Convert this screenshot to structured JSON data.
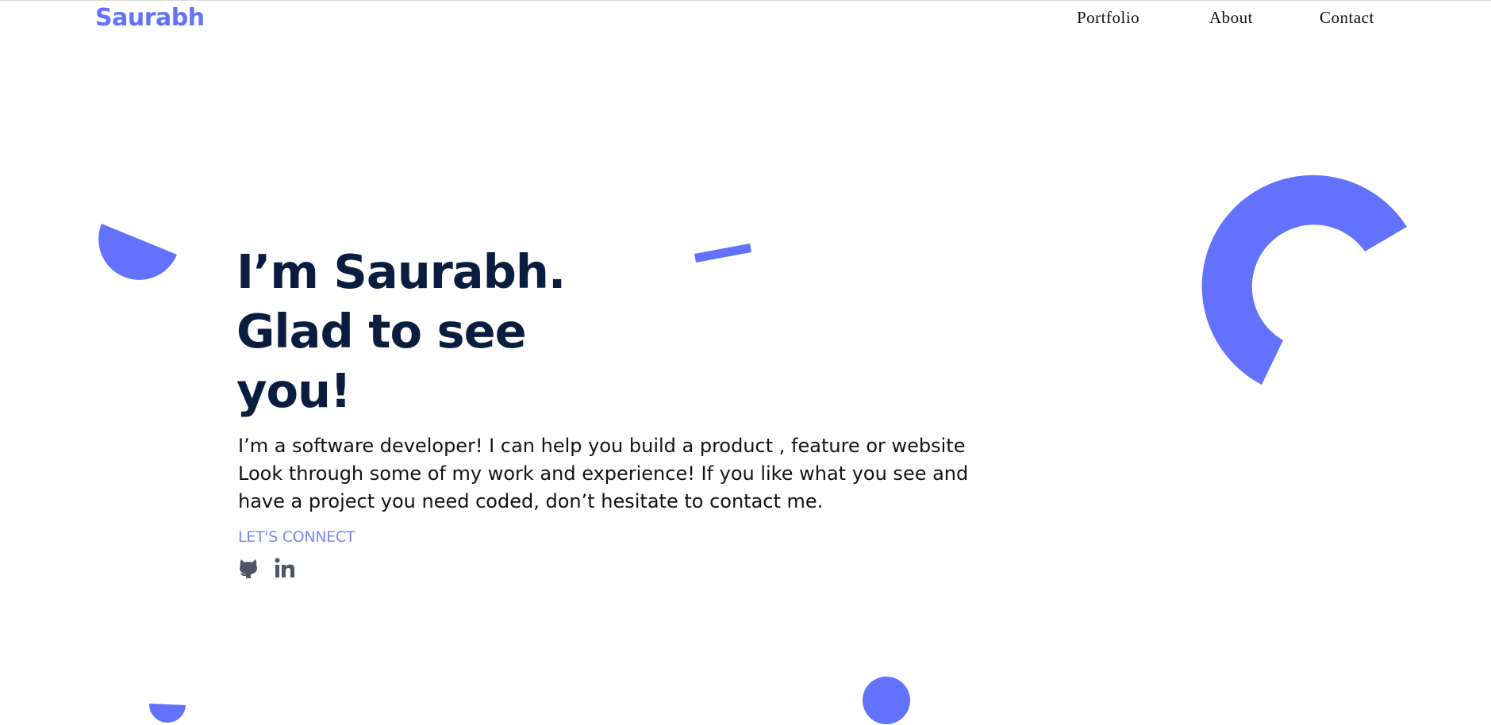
{
  "header": {
    "brand": "Saurabh",
    "nav": [
      {
        "label": "Portfolio"
      },
      {
        "label": "About"
      },
      {
        "label": "Contact"
      }
    ]
  },
  "hero": {
    "headline_lines": [
      "I’m Saurabh.",
      "Glad to see",
      "you!"
    ],
    "intro_lines": [
      "I’m a software developer! I can help you build a product , feature or website",
      "Look through some of my work and experience! If you like what you see and",
      "have a project you need coded, don’t hesitate to contact me."
    ],
    "connect_label": "LET'S CONNECT",
    "social": [
      {
        "icon": "github-icon"
      },
      {
        "icon": "linkedin-icon"
      }
    ]
  },
  "colors": {
    "accent": "#6272ff",
    "heading": "#0b1d3f",
    "connect": "#7b86f7",
    "social_icon": "#4d5566"
  }
}
